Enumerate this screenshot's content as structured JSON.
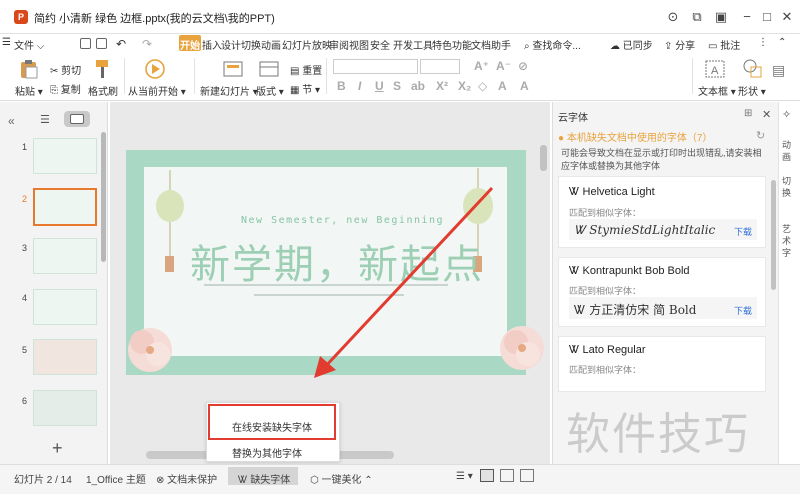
{
  "window": {
    "title": "简约 小清新 绿色 边框.pptx(我的云文档\\我的PPT)",
    "logo_letter": "P"
  },
  "menu": {
    "file": "文件",
    "tabs": [
      "开始",
      "插入",
      "设计",
      "切换",
      "动画",
      "幻灯片放映",
      "审阅",
      "视图",
      "安全",
      "开发工具",
      "特色功能",
      "文档助手"
    ],
    "search": "查找命令...",
    "sync": "已同步",
    "share": "分享",
    "annotate": "批注"
  },
  "ribbon": {
    "paste": "粘贴",
    "cut": "剪切",
    "copy": "复制",
    "format_painter": "格式刷",
    "play_from_current": "从当前开始",
    "new_slide": "新建幻灯片",
    "layout": "版式",
    "section": "节",
    "reset": "重置",
    "textbox": "文本框",
    "shape": "形状"
  },
  "thumbnails": [
    {
      "num": "1"
    },
    {
      "num": "2"
    },
    {
      "num": "3"
    },
    {
      "num": "4"
    },
    {
      "num": "5"
    },
    {
      "num": "6"
    }
  ],
  "slide": {
    "subtitle": "New Semester, new Beginning",
    "title": "新学期，新起点"
  },
  "panel": {
    "title": "云字体",
    "warning": "本机缺失文档中使用的字体（7）",
    "hint": "可能会导致文档在显示或打印时出现错乱,请安装相应字体或替换为其他字体",
    "match_label": "匹配到相似字体：",
    "download": "下载",
    "fonts": [
      {
        "name": "Helvetica Light",
        "match": "StymieStdLightItalic"
      },
      {
        "name": "Kontrapunkt Bob Bold",
        "match": "方正清仿宋 简 Bold"
      },
      {
        "name": "Lato Regular",
        "match": ""
      }
    ],
    "side_tabs": [
      "动",
      "画",
      "切",
      "换",
      "艺",
      "术",
      "字"
    ]
  },
  "popup": {
    "install": "在线安装缺失字体",
    "replace": "替换为其他字体"
  },
  "status": {
    "slide_pos": "幻灯片 2 / 14",
    "theme": "1_Office 主题",
    "protect": "文档未保护",
    "missing_fonts": "缺失字体",
    "beautify": "一键美化"
  },
  "watermark": "软件技巧",
  "colors": {
    "accent_orange": "#e8a33d",
    "highlight_red": "#e23b30",
    "slide_green": "#a9d9c4",
    "title_green": "#9ccfb4",
    "link_blue": "#2a6fd6"
  }
}
